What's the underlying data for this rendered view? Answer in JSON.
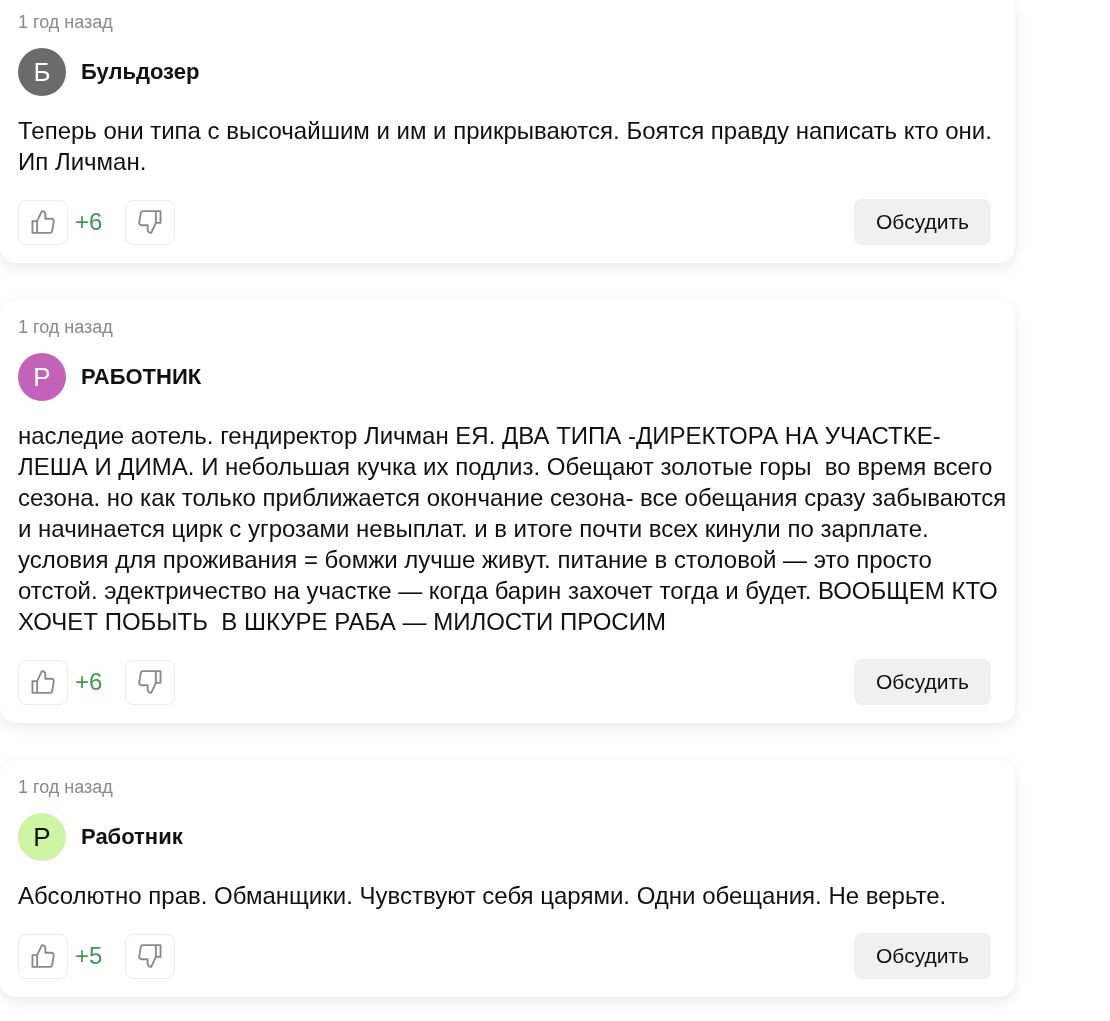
{
  "comments": [
    {
      "time": "1 год назад",
      "author": {
        "initial": "Б",
        "name": "Бульдозер",
        "color": "#6b6b6b"
      },
      "text": "Теперь они типа с высочайшим и им и прикрываются. Боятся правду написать кто они. Ип Личман.",
      "likes": "+6",
      "discuss_button": "Обсудить"
    },
    {
      "time": "1 год назад",
      "author": {
        "initial": "Р",
        "name": "РАБОТНИК",
        "color": "#c262b9"
      },
      "text": "наследие аотель. гендиректор Личман ЕЯ. ДВА ТИПА -ДИРЕКТОРА НА УЧАСТКЕ- ЛЕША И ДИМА. И небольшая кучка их подлиз. Обещают золотые горы  во время всего сезона. но как только приближается окончание сезона- все обещания сразу забываются и начинается цирк с угрозами невыплат. и в итоге почти всех кинули по зарплате. условия для проживания = бомжи лучше живут. питание в столовой — это просто отстой. эдектричество на участке — когда барин захочет тогда и будет. ВООБЩЕМ КТО ХОЧЕТ ПОБЫТЬ  В ШКУРЕ РАБА — МИЛОСТИ ПРОСИМ",
      "likes": "+6",
      "discuss_button": "Обсудить"
    },
    {
      "time": "1 год назад",
      "author": {
        "initial": "Р",
        "name": "Работник",
        "color": "#cdf5a3"
      },
      "text": "Абсолютно прав. Обманщики. Чувствуют себя царями. Одни обещания. Не верьте.",
      "likes": "+5",
      "discuss_button": "Обсудить"
    }
  ]
}
